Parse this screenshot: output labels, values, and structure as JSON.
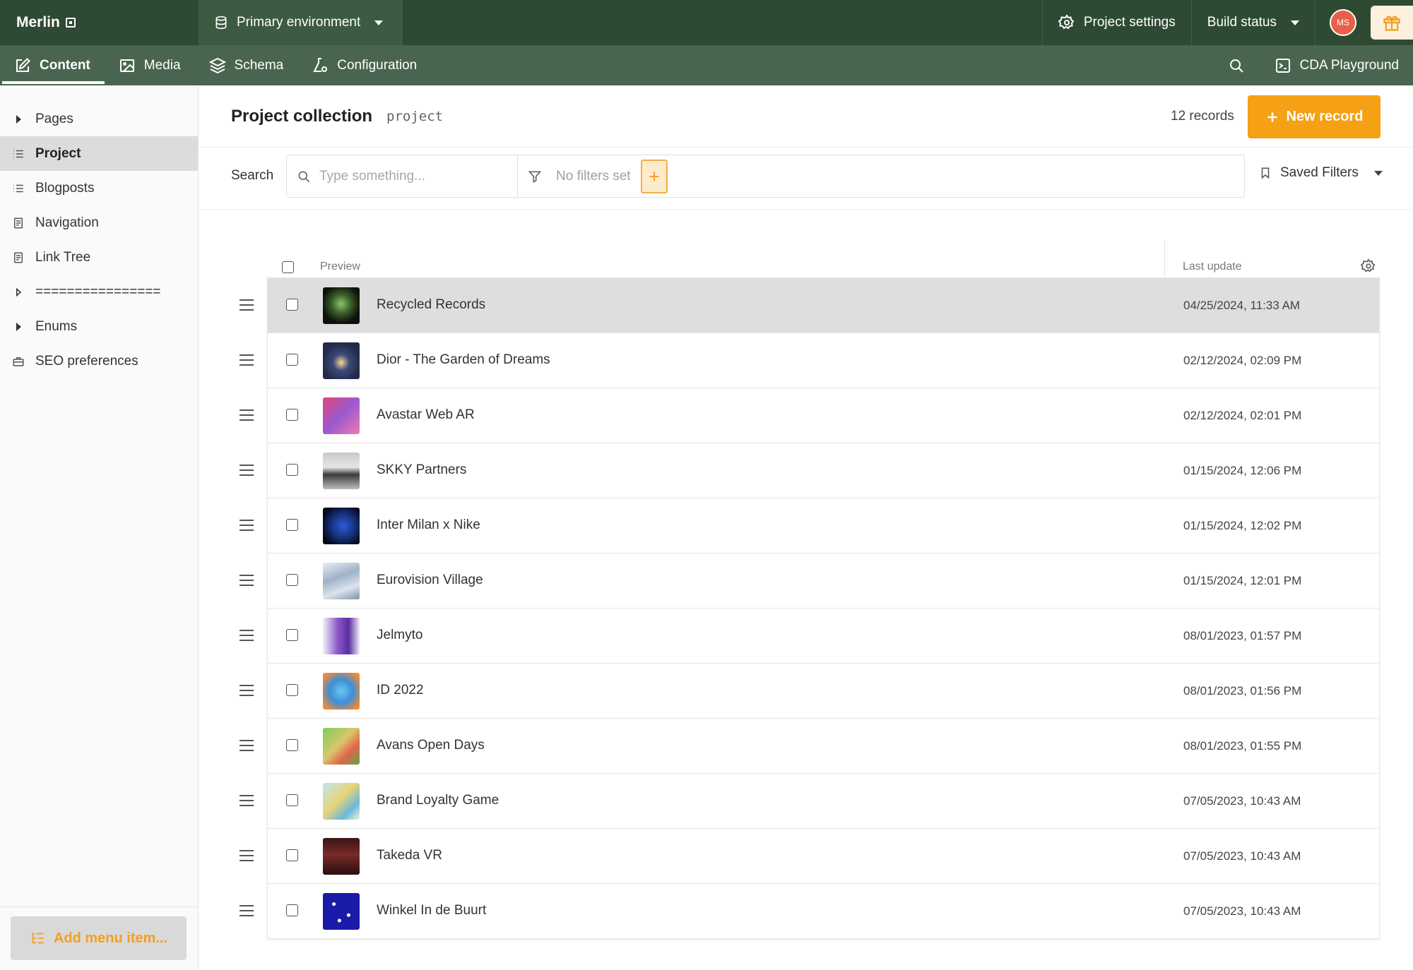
{
  "topbar": {
    "brand": "Merlin",
    "environment": "Primary environment",
    "project_settings": "Project settings",
    "build_status": "Build status",
    "avatar_initials": "MS"
  },
  "nav": {
    "tabs": [
      {
        "label": "Content",
        "icon": "edit-icon",
        "active": true
      },
      {
        "label": "Media",
        "icon": "image-icon",
        "active": false
      },
      {
        "label": "Schema",
        "icon": "layers-icon",
        "active": false
      },
      {
        "label": "Configuration",
        "icon": "flask-gear-icon",
        "active": false
      }
    ],
    "cda_playground": "CDA Playground"
  },
  "sidebar": {
    "items": [
      {
        "label": "Pages",
        "icon": "triangle-right-icon"
      },
      {
        "label": "Project",
        "icon": "list-icon",
        "active": true
      },
      {
        "label": "Blogposts",
        "icon": "list-icon"
      },
      {
        "label": "Navigation",
        "icon": "document-icon"
      },
      {
        "label": "Link Tree",
        "icon": "document-icon"
      },
      {
        "label": "================",
        "icon": "triangle-right-icon"
      },
      {
        "label": "Enums",
        "icon": "triangle-right-icon"
      },
      {
        "label": "SEO preferences",
        "icon": "toolbox-icon"
      }
    ],
    "add_menu_item": "Add menu item..."
  },
  "main": {
    "title": "Project collection",
    "api_key": "project",
    "record_count": "12 records",
    "new_record": "New record",
    "search_label": "Search",
    "search_placeholder": "Type something...",
    "filters_text": "No filters set",
    "saved_filters": "Saved Filters",
    "columns": {
      "preview": "Preview",
      "last_update": "Last update"
    }
  },
  "records": [
    {
      "title": "Recycled Records",
      "date": "04/25/2024, 11:33 AM"
    },
    {
      "title": "Dior - The Garden of Dreams",
      "date": "02/12/2024, 02:09 PM"
    },
    {
      "title": "Avastar Web AR",
      "date": "02/12/2024, 02:01 PM"
    },
    {
      "title": "SKKY Partners",
      "date": "01/15/2024, 12:06 PM"
    },
    {
      "title": "Inter Milan x Nike",
      "date": "01/15/2024, 12:02 PM"
    },
    {
      "title": "Eurovision Village",
      "date": "01/15/2024, 12:01 PM"
    },
    {
      "title": "Jelmyto",
      "date": "08/01/2023, 01:57 PM"
    },
    {
      "title": "ID 2022",
      "date": "08/01/2023, 01:56 PM"
    },
    {
      "title": "Avans Open Days",
      "date": "08/01/2023, 01:55 PM"
    },
    {
      "title": "Brand Loyalty Game",
      "date": "07/05/2023, 10:43 AM"
    },
    {
      "title": "Takeda VR",
      "date": "07/05/2023, 10:43 AM"
    },
    {
      "title": "Winkel In de Buurt",
      "date": "07/05/2023, 10:43 AM"
    }
  ],
  "colors": {
    "topbar": "#2e4a33",
    "navbar": "#4a654f",
    "accent": "#f5a015",
    "selected_row": "#dedede"
  }
}
